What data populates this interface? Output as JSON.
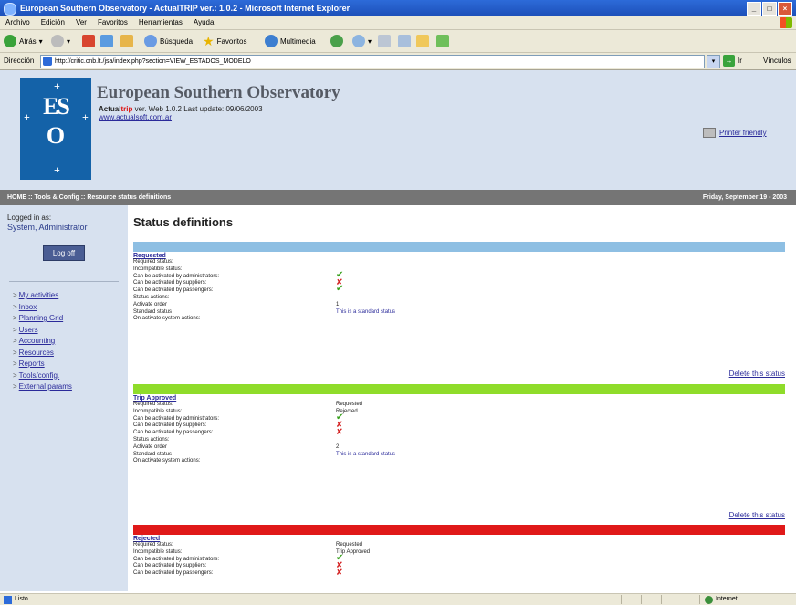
{
  "window": {
    "title": "European Southern Observatory - ActualTRIP ver.: 1.0.2 - Microsoft Internet Explorer",
    "controls": [
      "_",
      "□",
      "×"
    ]
  },
  "menubar": [
    "Archivo",
    "Edición",
    "Ver",
    "Favoritos",
    "Herramientas",
    "Ayuda"
  ],
  "toolbar": {
    "back": "Atrás",
    "search": "Búsqueda",
    "favorites": "Favoritos",
    "multimedia": "Multimedia"
  },
  "addressbar": {
    "label": "Dirección",
    "url": "http://critic.cnb.lt./jsa/index.php?section=VIEW_ESTADOS_MODELO",
    "go": "Ir",
    "links": "Vínculos"
  },
  "header": {
    "logo_text": "ES O",
    "org_title": "European Southern Observatory",
    "version_brand_a": "Actual",
    "version_brand_b": "trip",
    "version_rest": " ver. Web 1.0.2 Last update: 09/06/2003",
    "site_link": "www.actualsoft.com.ar",
    "print_friendly": "Printer friendly"
  },
  "breadcrumb": {
    "path": "HOME :: Tools & Config :: Resource status definitions",
    "date": "Friday, September 19 - 2003"
  },
  "sidebar": {
    "logged_label": "Logged in as:",
    "user": "System, Administrator",
    "logoff": "Log off",
    "items": [
      {
        "label": "My activities"
      },
      {
        "label": "Inbox"
      },
      {
        "label": "Planning Grid"
      },
      {
        "label": "Users"
      },
      {
        "label": "Accounting"
      },
      {
        "label": "Resources"
      },
      {
        "label": "Reports"
      },
      {
        "label": "Tools/config."
      },
      {
        "label": "External params"
      }
    ]
  },
  "main": {
    "title": "Status definitions",
    "delete_label": "Delete this status",
    "sections": [
      {
        "name": "Requested",
        "color": "#8ebfe3",
        "rows": [
          {
            "label": "Required status:",
            "value": ""
          },
          {
            "label": "Incompatible status:",
            "value": ""
          },
          {
            "label": "Can be activated by administrators:",
            "value": "✔",
            "kind": "ok"
          },
          {
            "label": "Can be activated by suppliers:",
            "value": "✘",
            "kind": "no"
          },
          {
            "label": "Can be activated by passengers:",
            "value": "✔",
            "kind": "ok"
          },
          {
            "label": "Status actions:",
            "value": ""
          },
          {
            "label": "Activate order",
            "value": "1"
          },
          {
            "label": "Standard status",
            "value": "This is a standard status",
            "kind": "link"
          },
          {
            "label": "On activate system actions:",
            "value": ""
          }
        ]
      },
      {
        "name": "Trip Approved",
        "color": "#8fdc2a",
        "rows": [
          {
            "label": "Required status:",
            "value": "Requested"
          },
          {
            "label": "Incompatible status:",
            "value": "Rejected"
          },
          {
            "label": "Can be activated by administrators:",
            "value": "✔",
            "kind": "ok"
          },
          {
            "label": "Can be activated by suppliers:",
            "value": "✘",
            "kind": "no"
          },
          {
            "label": "Can be activated by passengers:",
            "value": "✘",
            "kind": "no"
          },
          {
            "label": "Status actions:",
            "value": ""
          },
          {
            "label": "Activate order",
            "value": "2"
          },
          {
            "label": "Standard status",
            "value": "This is a standard status",
            "kind": "link"
          },
          {
            "label": "On activate system actions:",
            "value": ""
          }
        ]
      },
      {
        "name": "Rejected",
        "color": "#e01919",
        "rows": [
          {
            "label": "Required status:",
            "value": "Requested"
          },
          {
            "label": "Incompatible status:",
            "value": "Trip Approved"
          },
          {
            "label": "Can be activated by administrators:",
            "value": "✔",
            "kind": "ok"
          },
          {
            "label": "Can be activated by suppliers:",
            "value": "✘",
            "kind": "no"
          },
          {
            "label": "Can be activated by passengers:",
            "value": "✘",
            "kind": "no"
          }
        ]
      }
    ]
  },
  "statusbar": {
    "left": "Listo",
    "zone": "Internet"
  }
}
